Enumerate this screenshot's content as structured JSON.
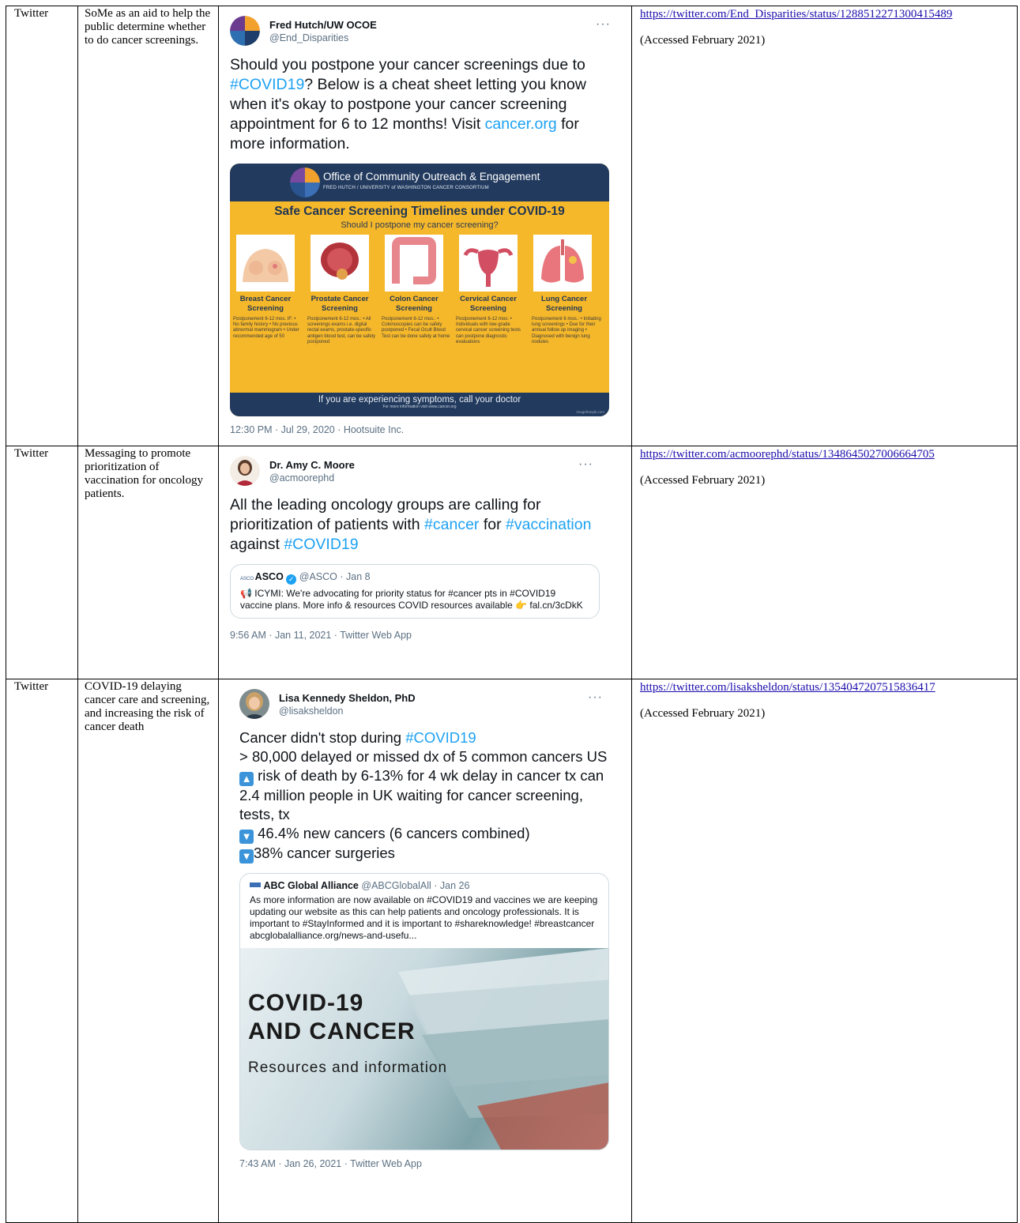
{
  "rows": [
    {
      "platform": "Twitter",
      "description": "SoMe as an aid to help the public determine whether to do cancer screenings.",
      "url": "https://twitter.com/End_Disparities/status/1288512271300415489",
      "accessed": "(Accessed February 2021)",
      "tweet": {
        "name": "Fred Hutch/UW OCOE",
        "handle": "@End_Disparities",
        "more": "···",
        "body_parts": [
          "Should you postpone your cancer screenings due to ",
          "#COVID19",
          "? Below is a cheat sheet letting you know when it's okay to postpone your cancer screening appointment for 6 to 12 months! Visit ",
          "cancer.org",
          " for more information."
        ],
        "meta": "12:30 PM · Jul 29, 2020 · Hootsuite Inc."
      },
      "infographic": {
        "org": "Office of Community Outreach & Engagement",
        "org_sub": "FRED HUTCH / UNIVERSITY of WASHINGTON CANCER CONSORTIUM",
        "title": "Safe Cancer Screening Timelines under COVID-19",
        "question": "Should I postpone my cancer screening?",
        "screenings": [
          {
            "name": "Breast Cancer Screening",
            "text": "Postponement 6-12 mos. IF: • No family history • No previous abnormal mammogram • Under recommended age of 50"
          },
          {
            "name": "Prostate Cancer Screening",
            "text": "Postponement 6-12 mos.: • All screenings exams i.e. digital rectal exams, prostate-specific antigen blood test, can be safely postponed"
          },
          {
            "name": "Colon Cancer Screening",
            "text": "Postponement 6-12 mos.: • Colonoscopies can be safely postponed • Fecal Ocult Blood Test can be done safely at home"
          },
          {
            "name": "Cervical Cancer Screening",
            "text": "Postponement 6-12 mos: • Individuals with low-grade cervical cancer screening tests can postpone diagnostic evaluations"
          },
          {
            "name": "Lung Cancer Screening",
            "text": "Postponement 6 mos.: • Initiating lung screenings • Due for their annual follow up imaging • Diagnosed with benign lung nodules"
          }
        ],
        "footer": "If you are experiencing symptoms, call your doctor",
        "footer_small": "For more information visit www.cancer.org",
        "credit": "imagefreepik.com"
      }
    },
    {
      "platform": "Twitter",
      "description": "Messaging to promote prioritization of vaccination for oncology patients.",
      "url": "https://twitter.com/acmoorephd/status/1348645027006664705",
      "accessed": "(Accessed February 2021)",
      "tweet": {
        "name": "Dr. Amy C. Moore",
        "handle": "@acmoorephd",
        "more": "···",
        "body_parts": [
          "All the leading oncology groups are calling for prioritization of patients with ",
          "#cancer",
          " for ",
          "#vaccination",
          " against ",
          "#COVID19"
        ],
        "quote_name": "ASCO",
        "quote_handle": "@ASCO · Jan 8",
        "quote_text": "📢 ICYMI: We're advocating for priority status for #cancer pts in #COVID19 vaccine plans. More info & resources COVID resources available 👉 fal.cn/3cDkK",
        "meta": "9:56 AM · Jan 11, 2021 · Twitter Web App"
      }
    },
    {
      "platform": "Twitter",
      "description": "COVID-19 delaying cancer care and screening, and increasing the risk of cancer death",
      "url": "https://twitter.com/lisaksheldon/status/1354047207515836417",
      "accessed": "(Accessed February 2021)",
      "tweet": {
        "name": "Lisa Kennedy Sheldon, PhD",
        "handle": "@lisaksheldon",
        "more": "···",
        "line1a": "Cancer didn't stop during ",
        "line1b": "#COVID19",
        "line2": "> 80,000 delayed or missed dx of 5 common cancers US",
        "line3": "risk of death by 6-13% for 4 wk delay in cancer tx can",
        "line4": "2.4 million people in UK waiting for cancer screening, tests, tx",
        "line5": "46.4% new cancers (6 cancers combined)",
        "line6": "38% cancer surgeries",
        "quote_name": "ABC Global Alliance",
        "quote_handle": "@ABCGlobalAll · Jan 26",
        "quote_text": "As more information are now available on #COVID19 and vaccines we are keeping updating our website as this can help patients and oncology professionals. It is important to #StayInformed and it is important to #shareknowledge! #breastcancer abcglobalalliance.org/news-and-usefu...",
        "img_line1": "COVID-19",
        "img_line2": "AND CANCER",
        "img_line3": "Resources and information",
        "meta": "7:43 AM · Jan 26, 2021 · Twitter Web App"
      }
    }
  ]
}
